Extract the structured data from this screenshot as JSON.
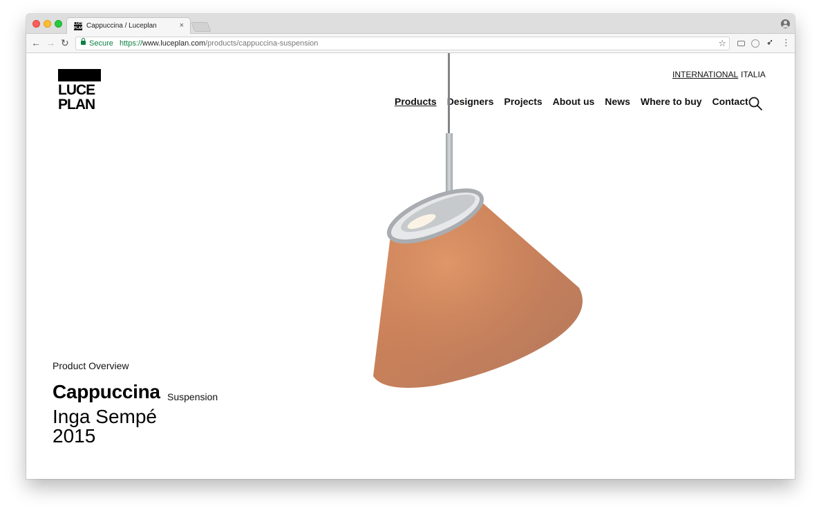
{
  "browser": {
    "tab": {
      "favicon_text": "LUCE PLAN",
      "title": "Cappuccina / Luceplan",
      "close_glyph": "×"
    },
    "toolbar": {
      "back_glyph": "←",
      "forward_glyph": "→",
      "reload_glyph": "↻",
      "secure_label": "Secure",
      "url_scheme": "https://",
      "url_host": "www.luceplan.com",
      "url_path": "/products/cappuccina-suspension",
      "star_glyph": "☆",
      "extension_bird_glyph": "➶",
      "menu_glyph": "⋮"
    },
    "icons": [
      "lock-icon",
      "star-icon",
      "camera-icon",
      "circle-icon",
      "bird-icon",
      "profile-icon"
    ]
  },
  "site": {
    "logo": {
      "line1": "LUCE",
      "line2": "PLAN"
    },
    "languages": {
      "international": "INTERNATIONAL",
      "italia": "ITALIA"
    },
    "nav": {
      "products": "Products",
      "designers": "Designers",
      "projects": "Projects",
      "about": "About us",
      "news": "News",
      "where_to_buy": "Where to buy",
      "contact": "Contact"
    },
    "active_nav": "Products"
  },
  "product": {
    "section_label": "Product Overview",
    "name": "Cappuccina",
    "type": "Suspension",
    "designer": "Inga Sempé",
    "year": "2015",
    "image": "cappuccina-suspension-lamp",
    "colors": {
      "shade": "#c9825a",
      "frame": "#a9adb1"
    }
  }
}
